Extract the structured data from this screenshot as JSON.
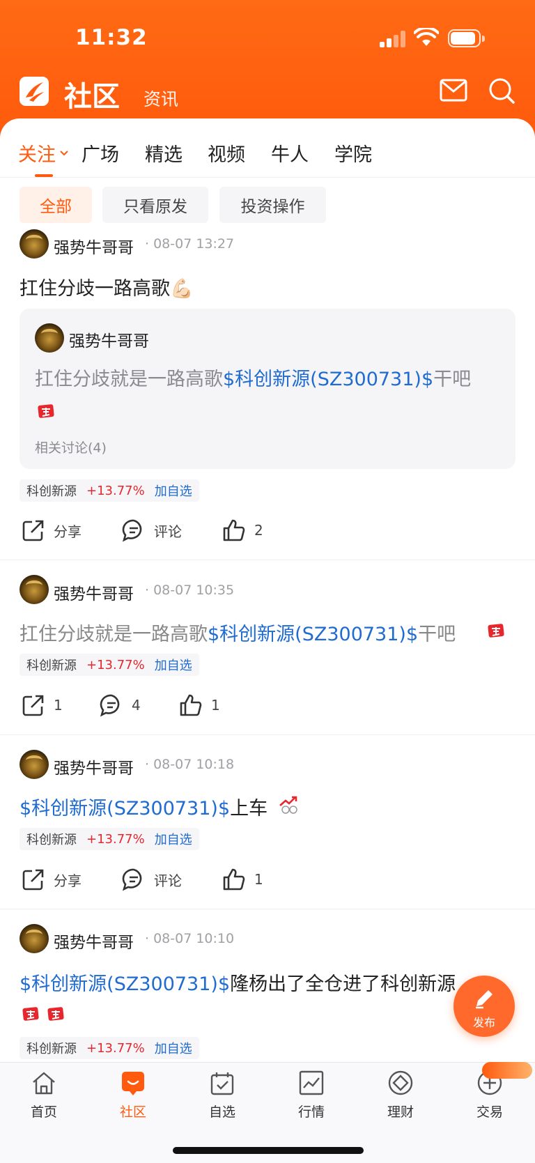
{
  "status_bar": {
    "time": "11:32"
  },
  "header": {
    "title": "社区",
    "subtitle": "资讯"
  },
  "tabs": [
    {
      "label": "关注",
      "active": true
    },
    {
      "label": "广场"
    },
    {
      "label": "精选"
    },
    {
      "label": "视频"
    },
    {
      "label": "牛人"
    },
    {
      "label": "学院"
    }
  ],
  "filters": [
    {
      "label": "全部",
      "active": true
    },
    {
      "label": "只看原发"
    },
    {
      "label": "投资操作"
    }
  ],
  "posts": [
    {
      "author": "强势牛哥哥",
      "time": "08-07 13:27",
      "text": "扛住分歧一路高歌💪🏻",
      "quote": {
        "author": "强势牛哥哥",
        "text_before": "扛住分歧就是一路高歌",
        "stock_link": "$科创新源(SZ300731)$",
        "text_after": "干吧",
        "related": "相关讨论(4)"
      },
      "stock": {
        "name": "科创新源",
        "change": "+13.77%",
        "add": "加自选"
      },
      "share": "分享",
      "comment": "评论",
      "likes": "2"
    },
    {
      "author": "强势牛哥哥",
      "time": "08-07 10:35",
      "text_before": "扛住分歧就是一路高歌",
      "stock_link": "$科创新源(SZ300731)$",
      "text_after": "干吧",
      "stock": {
        "name": "科创新源",
        "change": "+13.77%",
        "add": "加自选"
      },
      "share": "1",
      "comment": "4",
      "likes": "1"
    },
    {
      "author": "强势牛哥哥",
      "time": "08-07 10:18",
      "stock_link": "$科创新源(SZ300731)$",
      "text_after": "上车",
      "stock": {
        "name": "科创新源",
        "change": "+13.77%",
        "add": "加自选"
      },
      "share": "分享",
      "comment": "评论",
      "likes": "1"
    },
    {
      "author": "强势牛哥哥",
      "time": "08-07 10:10",
      "stock_link": "$科创新源(SZ300731)$",
      "text_after": "隆杨出了全仓进了科创新源",
      "stock": {
        "name": "科创新源",
        "change": "+13.77%",
        "add": "加自选"
      }
    }
  ],
  "fab": {
    "label": "发布"
  },
  "bottom_nav": [
    {
      "label": "首页",
      "icon": "home-icon"
    },
    {
      "label": "社区",
      "icon": "community-icon",
      "active": true
    },
    {
      "label": "自选",
      "icon": "watchlist-icon"
    },
    {
      "label": "行情",
      "icon": "market-icon"
    },
    {
      "label": "理财",
      "icon": "wealth-icon"
    },
    {
      "label": "交易",
      "icon": "trade-icon"
    }
  ],
  "colors": {
    "brand": "#ff5a0d",
    "link": "#1f6bd0",
    "rise": "#e8262e"
  }
}
